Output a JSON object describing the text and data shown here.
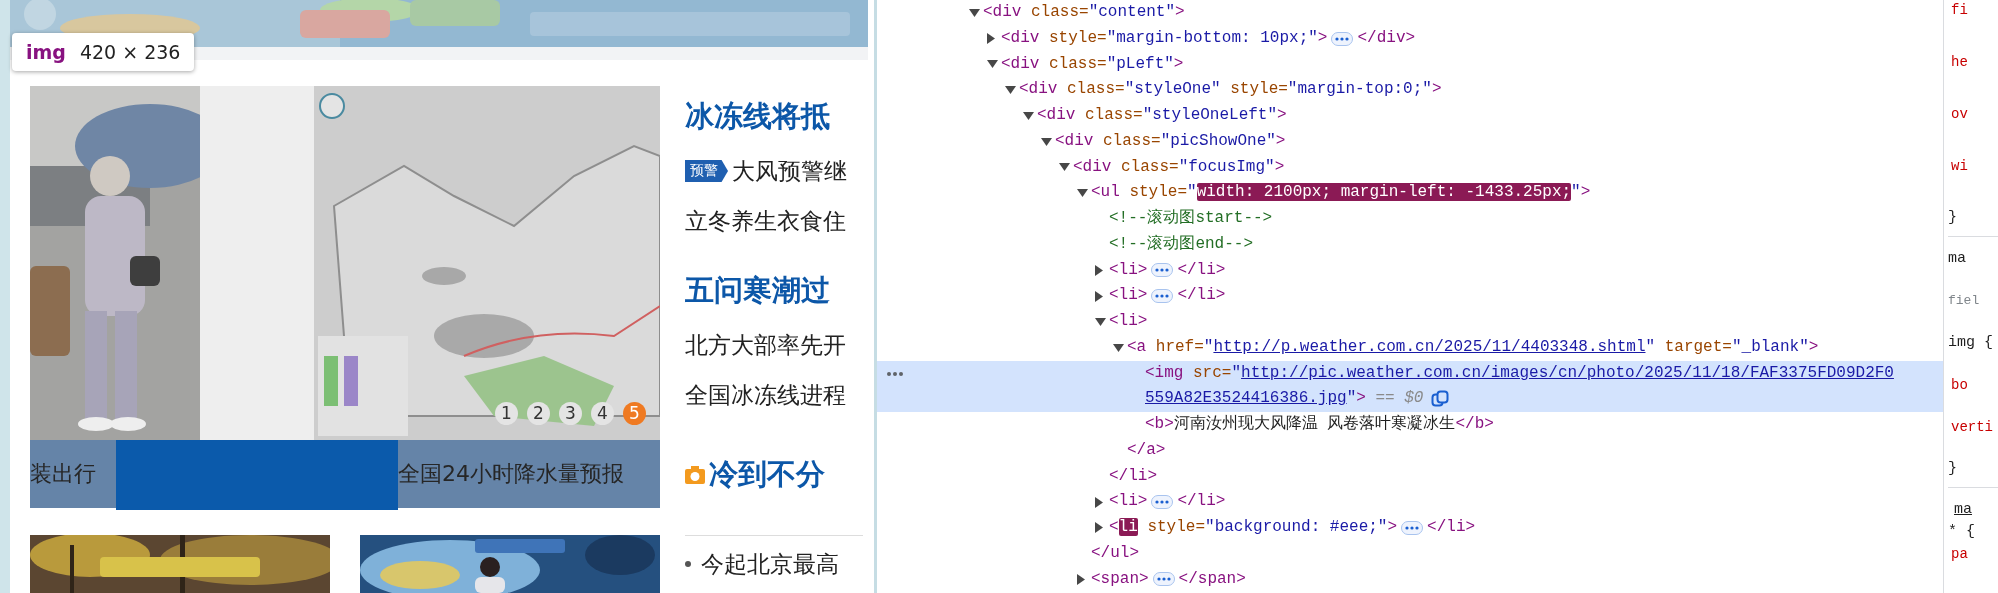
{
  "page": {
    "tooltip": {
      "tag": "img",
      "size": "420 × 236"
    },
    "slideshow": {
      "captions": [
        {
          "kind": "text",
          "text": "装出行"
        },
        {
          "kind": "block"
        },
        {
          "kind": "text",
          "text": "全国24小时降水量预报"
        }
      ],
      "pages": [
        {
          "label": "1",
          "selected": false
        },
        {
          "label": "2",
          "selected": false
        },
        {
          "label": "3",
          "selected": false
        },
        {
          "label": "4",
          "selected": false
        },
        {
          "label": "5",
          "selected": true
        }
      ]
    },
    "news": [
      {
        "kind": "headline",
        "text": "冰冻线将抵"
      },
      {
        "kind": "alert",
        "badge": "预警",
        "text": "大风预警继"
      },
      {
        "kind": "item",
        "text": "立冬养生衣食住"
      },
      {
        "kind": "headline",
        "text": "五问寒潮过"
      },
      {
        "kind": "item",
        "text": "北方大部率先开"
      },
      {
        "kind": "item",
        "text": "全国冰冻线进程"
      },
      {
        "text": "冷到不分"
      },
      {
        "kind": "bullet",
        "text": "今起北京最高"
      }
    ]
  },
  "elements": [
    {
      "selected": false,
      "expanded": true,
      "open": [
        [
          {
            "kind": "tag",
            "text": "<div"
          },
          {
            "kind": "attr",
            "text": " class="
          },
          {
            "kind": "value",
            "text": "\"content\""
          },
          {
            "kind": "tag",
            "text": ">"
          }
        ]
      ],
      "children": [
        {
          "selected": false,
          "expanded": false,
          "open": [
            [
              {
                "kind": "tag",
                "text": "<div"
              },
              {
                "kind": "attr",
                "text": " style="
              },
              {
                "kind": "value",
                "text": "\"margin-bottom: 10px;\""
              },
              {
                "kind": "tag",
                "text": ">"
              }
            ]
          ],
          "close": [
            {
              "kind": "tag",
              "text": "</div>"
            }
          ]
        },
        {
          "selected": false,
          "expanded": true,
          "open": [
            [
              {
                "kind": "tag",
                "text": "<div"
              },
              {
                "kind": "attr",
                "text": " class="
              },
              {
                "kind": "value",
                "text": "\"pLeft\""
              },
              {
                "kind": "tag",
                "text": ">"
              }
            ]
          ],
          "children": [
            {
              "selected": false,
              "expanded": true,
              "open": [
                [
                  {
                    "kind": "tag",
                    "text": "<div"
                  },
                  {
                    "kind": "attr",
                    "text": " class="
                  },
                  {
                    "kind": "value",
                    "text": "\"styleOne\""
                  },
                  {
                    "kind": "attr",
                    "text": " style="
                  },
                  {
                    "kind": "value",
                    "text": "\"margin-top:0;\""
                  },
                  {
                    "kind": "tag",
                    "text": ">"
                  }
                ]
              ],
              "children": [
                {
                  "selected": false,
                  "expanded": true,
                  "open": [
                    [
                      {
                        "kind": "tag",
                        "text": "<div"
                      },
                      {
                        "kind": "attr",
                        "text": " class="
                      },
                      {
                        "kind": "value",
                        "text": "\"styleOneLeft\""
                      },
                      {
                        "kind": "tag",
                        "text": ">"
                      }
                    ]
                  ],
                  "children": [
                    {
                      "selected": false,
                      "expanded": true,
                      "open": [
                        [
                          {
                            "kind": "tag",
                            "text": "<div"
                          },
                          {
                            "kind": "attr",
                            "text": " class="
                          },
                          {
                            "kind": "value",
                            "text": "\"picShowOne\""
                          },
                          {
                            "kind": "tag",
                            "text": ">"
                          }
                        ]
                      ],
                      "children": [
                        {
                          "selected": false,
                          "expanded": true,
                          "open": [
                            [
                              {
                                "kind": "tag",
                                "text": "<div"
                              },
                              {
                                "kind": "attr",
                                "text": " class="
                              },
                              {
                                "kind": "value",
                                "text": "\"focusImg\""
                              },
                              {
                                "kind": "tag",
                                "text": ">"
                              }
                            ]
                          ],
                          "children": [
                            {
                              "selected": false,
                              "expanded": true,
                              "open": [
                                [
                                  {
                                    "kind": "tag",
                                    "text": "<ul"
                                  },
                                  {
                                    "kind": "attr",
                                    "text": " style="
                                  },
                                  {
                                    "kind": "value",
                                    "text": "\""
                                  },
                                  {
                                    "kind": "match",
                                    "text": "width: 2100px; margin-left: -1433.25px;"
                                  },
                                  {
                                    "kind": "value",
                                    "text": "\""
                                  },
                                  {
                                    "kind": "tag",
                                    "text": ">"
                                  }
                                ]
                              ],
                              "children": [
                                {
                                  "selected": false,
                                  "open": [
                                    [
                                      {
                                        "kind": "comment",
                                        "text": "<!--滚动图start-->"
                                      }
                                    ]
                                  ]
                                },
                                {
                                  "selected": false,
                                  "open": [
                                    [
                                      {
                                        "kind": "comment",
                                        "text": "<!--滚动图end-->"
                                      }
                                    ]
                                  ]
                                },
                                {
                                  "selected": false,
                                  "expanded": false,
                                  "open": [
                                    [
                                      {
                                        "kind": "tag",
                                        "text": "<li>"
                                      }
                                    ]
                                  ],
                                  "close": [
                                    {
                                      "kind": "tag",
                                      "text": "</li>"
                                    }
                                  ]
                                },
                                {
                                  "selected": false,
                                  "expanded": false,
                                  "open": [
                                    [
                                      {
                                        "kind": "tag",
                                        "text": "<li>"
                                      }
                                    ]
                                  ],
                                  "close": [
                                    {
                                      "kind": "tag",
                                      "text": "</li>"
                                    }
                                  ]
                                },
                                {
                                  "selected": false,
                                  "expanded": true,
                                  "open": [
                                    [
                                      {
                                        "kind": "tag",
                                        "text": "<li>"
                                      }
                                    ]
                                  ],
                                  "children": [
                                    {
                                      "selected": false,
                                      "expanded": true,
                                      "open": [
                                        [
                                          {
                                            "kind": "tag",
                                            "text": "<a"
                                          },
                                          {
                                            "kind": "attr",
                                            "text": " href="
                                          },
                                          {
                                            "kind": "value",
                                            "text": "\""
                                          },
                                          {
                                            "kind": "link",
                                            "text": "http://p.weather.com.cn/2025/11/4403348.shtml"
                                          },
                                          {
                                            "kind": "value",
                                            "text": "\""
                                          },
                                          {
                                            "kind": "attr",
                                            "text": " target="
                                          },
                                          {
                                            "kind": "value",
                                            "text": "\"_blank\""
                                          },
                                          {
                                            "kind": "tag",
                                            "text": ">"
                                          }
                                        ]
                                      ],
                                      "children": [
                                        {
                                          "selected": true,
                                          "open": [
                                            [
                                              {
                                                "kind": "tag",
                                                "text": "<img"
                                              },
                                              {
                                                "kind": "attr",
                                                "text": " src="
                                              },
                                              {
                                                "kind": "value",
                                                "text": "\""
                                              },
                                              {
                                                "kind": "link",
                                                "text": "http://pic.weather.com.cn/images/cn/photo/2025/11/18/FAF3375FD09D2F0"
                                              }
                                            ],
                                            [
                                              {
                                                "kind": "link",
                                                "text": "559A82E3524416386.jpg"
                                              },
                                              {
                                                "kind": "value",
                                                "text": "\""
                                              },
                                              {
                                                "kind": "tag",
                                                "text": ">"
                                              },
                                              {
                                                "kind": "hint",
                                                "text": " == $0"
                                              }
                                            ]
                                          ]
                                        },
                                        {
                                          "selected": false,
                                          "open": [
                                            [
                                              {
                                                "kind": "tag",
                                                "text": "<b>"
                                              },
                                              {
                                                "kind": "text",
                                                "text": "河南汝州现大风降温 风卷落叶寒凝冰生"
                                              },
                                              {
                                                "kind": "tag",
                                                "text": "</b>"
                                              }
                                            ]
                                          ]
                                        }
                                      ],
                                      "close": [
                                        {
                                          "kind": "tag",
                                          "text": "</a>"
                                        }
                                      ]
                                    }
                                  ],
                                  "close": [
                                    {
                                      "kind": "tag",
                                      "text": "</li>"
                                    }
                                  ]
                                },
                                {
                                  "selected": false,
                                  "expanded": false,
                                  "open": [
                                    [
                                      {
                                        "kind": "tag",
                                        "text": "<li>"
                                      }
                                    ]
                                  ],
                                  "close": [
                                    {
                                      "kind": "tag",
                                      "text": "</li>"
                                    }
                                  ]
                                },
                                {
                                  "selected": false,
                                  "expanded": false,
                                  "open": [
                                    [
                                      {
                                        "kind": "tag",
                                        "text": "<"
                                      },
                                      {
                                        "kind": "match",
                                        "text": "li"
                                      },
                                      {
                                        "kind": "attr",
                                        "text": " style="
                                      },
                                      {
                                        "kind": "value",
                                        "text": "\"background: #eee;\""
                                      },
                                      {
                                        "kind": "tag",
                                        "text": ">"
                                      }
                                    ]
                                  ],
                                  "close": [
                                    {
                                      "kind": "tag",
                                      "text": "</li>"
                                    }
                                  ]
                                }
                              ],
                              "close": [
                                {
                                  "kind": "tag",
                                  "text": "</ul>"
                                }
                              ]
                            },
                            {
                              "selected": false,
                              "expanded": false,
                              "open": [
                                [
                                  {
                                    "kind": "tag",
                                    "text": "<span>"
                                  }
                                ]
                              ],
                              "close": [
                                {
                                  "kind": "tag",
                                  "text": "</span>"
                                }
                              ]
                            }
                          ]
                        }
                      ]
                    }
                  ]
                }
              ]
            }
          ]
        }
      ]
    }
  ],
  "styles": [
    [
      {
        "kind": "prop",
        "text": "fi"
      },
      {
        "kind": "prop",
        "text": "he"
      },
      {
        "kind": "prop",
        "text": "ov"
      },
      {
        "kind": "prop",
        "text": "wi"
      },
      {
        "kind": "plain",
        "text": "}"
      }
    ],
    [
      {
        "kind": "plain",
        "text": "ma"
      },
      {
        "kind": "origin",
        "text": "fiel"
      },
      {
        "kind": "plain",
        "text": "img {"
      },
      {
        "kind": "prop",
        "text": "bo"
      },
      {
        "kind": "prop",
        "text": "verti"
      },
      {
        "kind": "plain",
        "text": "}"
      }
    ],
    [
      {
        "kind": "link",
        "text": "ma"
      },
      {
        "kind": "plain",
        "text": "* {"
      },
      {
        "kind": "prop",
        "text": "pa"
      }
    ]
  ]
}
